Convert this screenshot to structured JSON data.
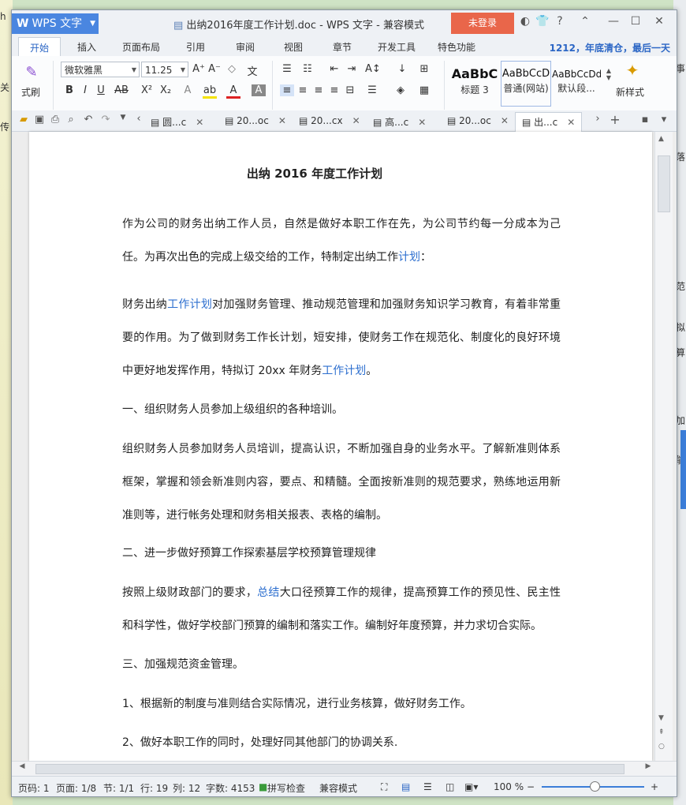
{
  "window": {
    "app_label": "WPS 文字",
    "title": "出纳2016年度工作计划.doc - WPS 文字 - 兼容模式",
    "login_label": "未登录"
  },
  "ribbon_tabs": [
    "开始",
    "插入",
    "页面布局",
    "引用",
    "审阅",
    "视图",
    "章节",
    "开发工具",
    "特色功能"
  ],
  "ribbon_note": "1212，年底清仓，最后一天",
  "toolbar": {
    "format_painter_label": "式刷",
    "font_name": "微软雅黑",
    "font_size": "11.25",
    "styles": [
      {
        "preview": "AaBbC",
        "name": "标题 3"
      },
      {
        "preview": "AaBbCcD",
        "name": "普通(网站)"
      },
      {
        "preview": "AaBbCcDd",
        "name": "默认段..."
      }
    ],
    "new_style_label": "新样式"
  },
  "doc_tabs": [
    {
      "label": "圆...c"
    },
    {
      "label": "20...oc"
    },
    {
      "label": "20...cx"
    },
    {
      "label": "高...c"
    },
    {
      "label": "20...oc"
    },
    {
      "label": "出...c"
    }
  ],
  "document": {
    "title": "出纳 2016 年度工作计划",
    "p1_a": "作为公司的财务出纳工作人员，自然是做好本职工作在先，为公司节约每一分成本为己任。为再次出色的完成上级交给的工作，特制定出纳工作",
    "p1_link": "计划",
    "p1_b": "：",
    "p2_a": "财务出纳",
    "p2_link1": "工作计划",
    "p2_b": "对加强财务管理、推动规范管理和加强财务知识学习教育，有着非常重要的作用。为了做到财务工作长计划，短安排，使财务工作在规范化、制度化的良好环境中更好地发挥作用，特拟订 20xx 年财务",
    "p2_link2": "工作计划",
    "p2_c": "。",
    "h1": "一、组织财务人员参加上级组织的各种培训。",
    "p3": "组织财务人员参加财务人员培训，提高认识，不断加强自身的业务水平。了解新准则体系框架，掌握和领会新准则内容，要点、和精髓。全面按新准则的规范要求，熟练地运用新准则等，进行帐务处理和财务相关报表、表格的编制。",
    "h2": "二、进一步做好预算工作探索基层学校预算管理规律",
    "p4_a": "按照上级财政部门的要求，",
    "p4_link": "总结",
    "p4_b": "大口径预算工作的规律，提高预算工作的预见性、民主性和科学性，做好学校部门预算的编制和落实工作。编制好年度预算，并力求切合实际。",
    "h3": "三、加强规范资金管理。",
    "i1": "1、根据新的制度与准则结合实际情况，进行业务核算，做好财务工作。",
    "i2": "2、做好本职工作的同时，处理好同其他部门的协调关系."
  },
  "status_bar": {
    "page_code": "页码: 1",
    "pages": "页面: 1/8",
    "section": "节: 1/1",
    "row": "行: 19",
    "col": "列: 12",
    "word_count": "字数: 4153",
    "spell_check": "拼写检查",
    "compat_mode": "兼容模式",
    "zoom": "100 %"
  },
  "background": {
    "left_texts": [
      "h",
      "关",
      "传"
    ],
    "right_texts": [
      "事",
      "落",
      "范",
      "拟",
      "算",
      "加",
      "能"
    ]
  },
  "colors": {
    "accent": "#4a86e0",
    "login": "#e9664a",
    "link": "#2d6fcf"
  }
}
